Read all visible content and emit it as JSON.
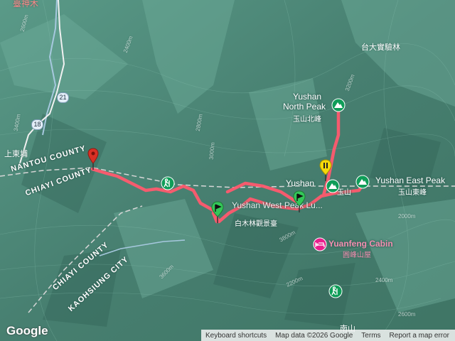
{
  "map": {
    "top_cut_label": "臺神木",
    "counties": {
      "nantou": "NANTOU COUNTY",
      "chiayi_upper": "CHIAYI COUNTY",
      "chiayi_lower": "CHIAYI COUNTY",
      "kaohsiung": "KAOHSIUNG CITY"
    },
    "places": {
      "forest": "台大實驗林",
      "shangdongpu": "上東埔",
      "nanshan": "南山",
      "baimu_cut": "Yushan West Peak Lu...",
      "baimu_cn": "白木林觀景臺",
      "yushan_short_en": "Yushan",
      "yushan_short_cn": "玉山"
    },
    "peaks": {
      "north_en_1": "Yushan",
      "north_en_2": "North Peak",
      "north_cn": "玉山北峰",
      "east_en": "Yushan East Peak",
      "east_cn": "玉山東峰"
    },
    "cabin": {
      "en": "Yuanfeng Cabin",
      "cn": "圓峰山屋"
    },
    "roads": [
      "21",
      "18"
    ],
    "elevations": [
      "2600m",
      "2400m",
      "2800m",
      "3000m",
      "3200m",
      "3400m",
      "3600m",
      "3800m",
      "2200m",
      "2000m"
    ],
    "colors": {
      "terrain": "#4e8a7a",
      "track": "#ff5a6e",
      "peak_icon": "#0f9d58",
      "cabin_icon": "#e91e8c",
      "pin_red": "#d93025",
      "pin_green": "#34c759",
      "pin_yellow": "#f5d90a"
    }
  },
  "footer": {
    "logo": "Google",
    "keyboard": "Keyboard shortcuts",
    "mapdata": "Map data ©2026 Google",
    "terms": "Terms",
    "report": "Report a map error"
  }
}
